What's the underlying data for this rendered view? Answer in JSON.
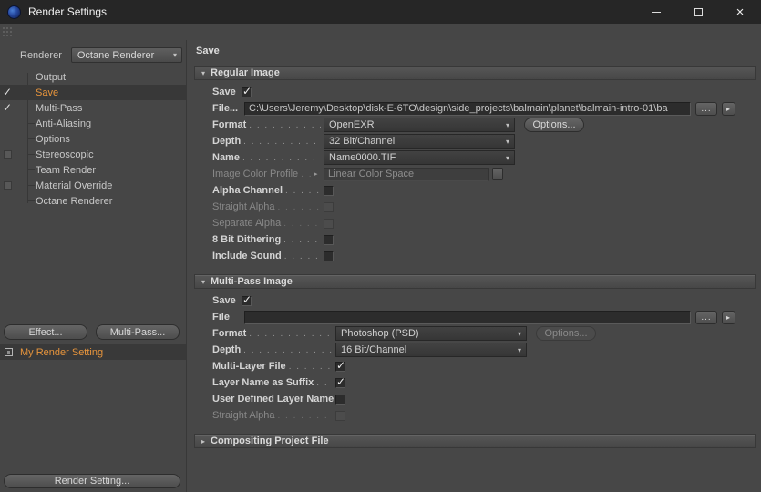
{
  "window": {
    "title": "Render Settings"
  },
  "icons": {
    "close": "×",
    "dropdown_arrow": "▾",
    "check": "✓",
    "browse": "...",
    "arrow_button": "▸",
    "section_expanded": "▾",
    "section_collapsed": "▸"
  },
  "colors": {
    "accent": "#E8953C",
    "titlebar": "#262626",
    "panel": "#464646",
    "field": "#2C2C2C"
  },
  "left": {
    "renderer_label": "Renderer",
    "renderer_value": "Octane Renderer",
    "tree": [
      "Output",
      "Save",
      "Multi-Pass",
      "Anti-Aliasing",
      "Options",
      "Stereoscopic",
      "Team Render",
      "Material Override",
      "Octane Renderer"
    ],
    "effect_button": "Effect...",
    "multipass_button": "Multi-Pass...",
    "active_setting": "My Render Setting",
    "render_setting_button": "Render Setting..."
  },
  "right": {
    "header": "Save",
    "regular": {
      "title": "Regular Image",
      "save_label": "Save",
      "file_label": "File...",
      "file_value": "C:\\Users\\Jeremy\\Desktop\\disk-E-6TO\\design\\side_projects\\balmain\\planet\\balmain-intro-01\\ba",
      "format_label": "Format",
      "format_value": "OpenEXR",
      "options_label": "Options...",
      "depth_label": "Depth",
      "depth_value": "32 Bit/Channel",
      "name_label": "Name",
      "name_value": "Name0000.TIF",
      "profile_label": "Image Color Profile",
      "profile_value": "Linear Color Space",
      "alpha_label": "Alpha Channel",
      "straight_label": "Straight Alpha",
      "separate_label": "Separate Alpha",
      "dither_label": "8 Bit Dithering",
      "sound_label": "Include Sound"
    },
    "multipass": {
      "title": "Multi-Pass Image",
      "save_label": "Save",
      "file_label": "File",
      "file_value": "",
      "format_label": "Format",
      "format_value": "Photoshop (PSD)",
      "options_label": "Options...",
      "depth_label": "Depth",
      "depth_value": "16 Bit/Channel",
      "multilayer_label": "Multi-Layer File",
      "suffix_label": "Layer Name as Suffix",
      "userdefined_label": "User Defined Layer Name",
      "straight_label": "Straight Alpha"
    },
    "compositing": {
      "title": "Compositing Project File"
    }
  }
}
